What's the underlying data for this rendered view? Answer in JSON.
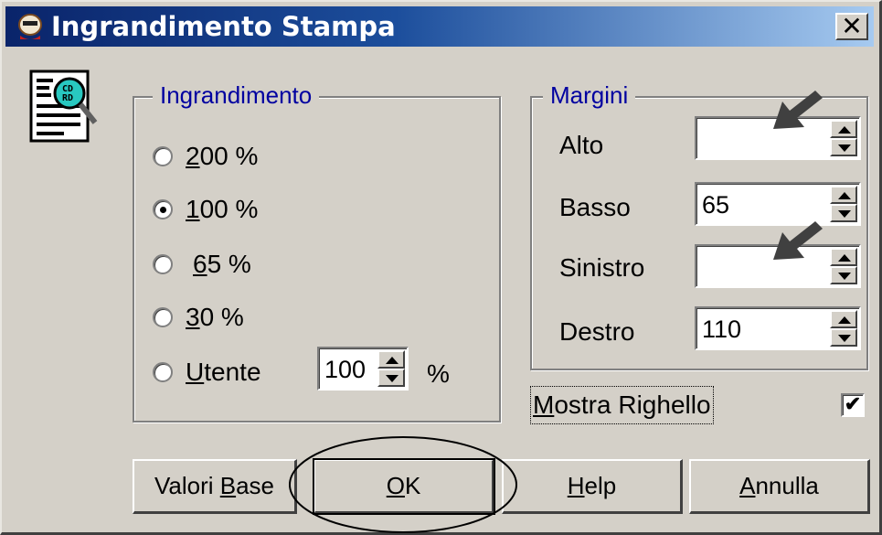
{
  "window": {
    "title": "Ingrandimento Stampa",
    "close_symbol": "✕"
  },
  "colors": {
    "title_start": "#0a246a",
    "title_end": "#a6caf0",
    "legend": "#0000a0",
    "face": "#d4d0c8"
  },
  "magnification": {
    "legend": "Ingrandimento",
    "options": [
      {
        "mnemonic": "2",
        "rest": "00 %",
        "prefix": "",
        "checked": false
      },
      {
        "mnemonic": "1",
        "rest": "00 %",
        "prefix": "",
        "checked": true
      },
      {
        "mnemonic": "6",
        "rest": "5 %",
        "prefix": " ",
        "checked": false
      },
      {
        "mnemonic": "3",
        "rest": "0 %",
        "prefix": "",
        "checked": false
      },
      {
        "mnemonic": "U",
        "rest": "tente",
        "prefix": "",
        "checked": false
      }
    ],
    "user_value": "100",
    "percent_sign": "%"
  },
  "margins": {
    "legend": "Margini",
    "rows": [
      {
        "label": "Alto",
        "value": ""
      },
      {
        "label": "Basso",
        "value": "65"
      },
      {
        "label": "Sinistro",
        "value": ""
      },
      {
        "label": "Destro",
        "value": "110"
      }
    ]
  },
  "ruler": {
    "mnemonic": "M",
    "rest": "ostra Righello",
    "checked": true,
    "check_mark": "✔"
  },
  "buttons": {
    "defaults": {
      "pre": "Valori ",
      "mnemonic": "B",
      "post": "ase"
    },
    "ok": {
      "pre": "",
      "mnemonic": "O",
      "post": "K"
    },
    "help": {
      "pre": "",
      "mnemonic": "H",
      "post": "elp"
    },
    "cancel": {
      "pre": "",
      "mnemonic": "A",
      "post": "nnulla"
    }
  }
}
